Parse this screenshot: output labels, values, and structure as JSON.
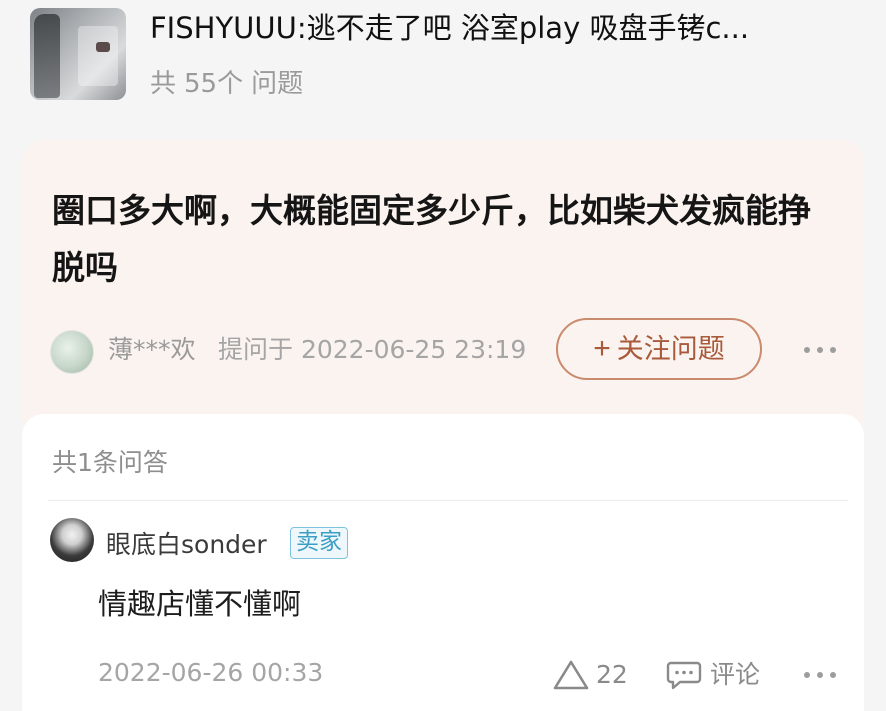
{
  "product": {
    "title": "FISHYUUU:逃不走了吧 浴室play 吸盘手铐c...",
    "question_count_prefix": "共",
    "question_count": "55个",
    "question_count_suffix": "问题"
  },
  "question": {
    "title": "圈口多大啊，大概能固定多少斤，比如柴犬发疯能挣脱吗",
    "asker": "薄***欢",
    "asked_at": "提问于 2022-06-25 23:19",
    "follow_plus": "+",
    "follow_label": "关注问题",
    "more_icon": "more-dots-icon"
  },
  "answers": {
    "count_label": "共1条问答",
    "items": [
      {
        "author": "眼底白sonder",
        "badge": "卖家",
        "text": "情趣店懂不懂啊",
        "date": "2022-06-26 00:33",
        "likes": "22",
        "comment_label": "评论"
      }
    ]
  },
  "colors": {
    "accent": "#c98a6d",
    "question_card_bg": "#fbf3ef",
    "badge_border": "#7ec3dd",
    "badge_text": "#3b9ec4"
  }
}
